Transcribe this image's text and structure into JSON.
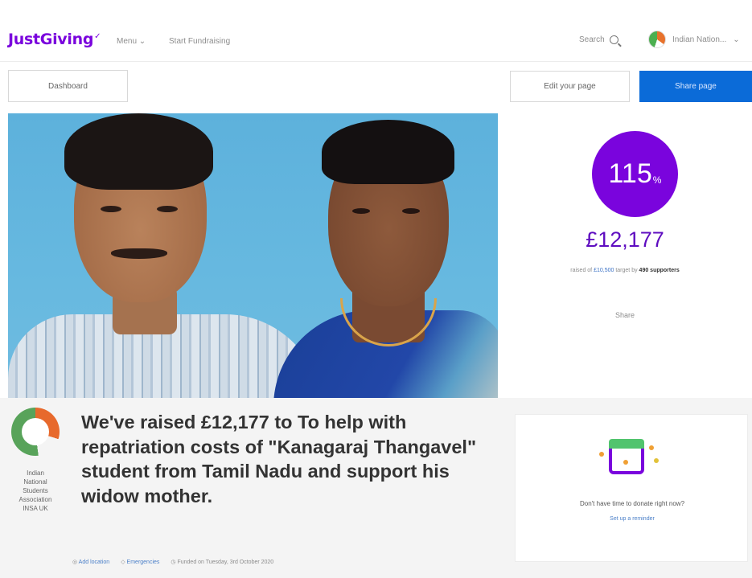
{
  "header": {
    "logo_text": "JustGiving",
    "menu_label": "Menu",
    "start_fundraising_label": "Start Fundraising",
    "search_label": "Search",
    "user_name": "Indian Nation..."
  },
  "actions": {
    "dashboard_label": "Dashboard",
    "edit_label": "Edit your page",
    "share_label": "Share page"
  },
  "progress": {
    "percent_value": "115",
    "percent_sign": "%",
    "amount_raised": "£12,177",
    "raised_prefix": "raised of",
    "target_amount": "£10,500",
    "target_mid": "target by",
    "supporters_count": "490 supporters",
    "share_label": "Share"
  },
  "fundraiser": {
    "headline": "We've raised £12,177 to To help with repatriation costs of \"Kanagaraj Thangavel\" student from Tamil Nadu and support his widow mother.",
    "org_name_lines": [
      "Indian",
      "National",
      "Students",
      "Association",
      "INSA UK"
    ],
    "meta_location": "Add location",
    "meta_tag": "Emergencies",
    "meta_date": "Funded on Tuesday, 3rd October 2020"
  },
  "reminder": {
    "title": "Don't have time to donate right now?",
    "link": "Set up a reminder"
  },
  "colors": {
    "brand_purple": "#7a04dd",
    "share_blue": "#0b6bd8",
    "amount_purple": "#5e0cc0"
  }
}
